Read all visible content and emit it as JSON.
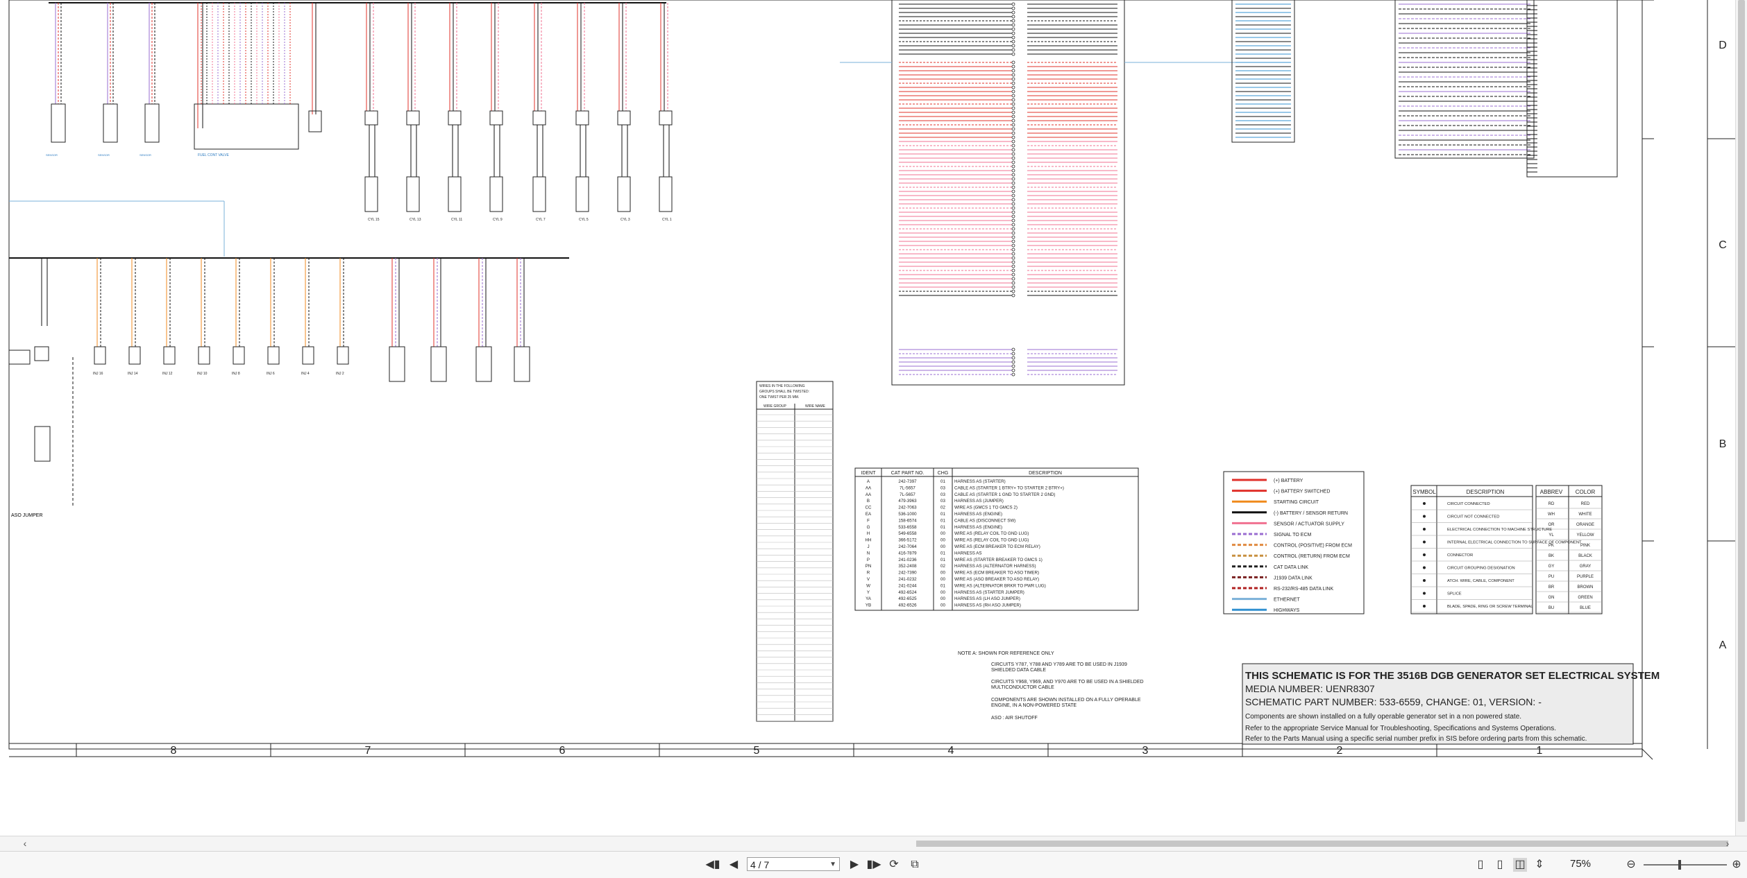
{
  "viewer": {
    "current_page": "4 / 7",
    "zoom": "75%",
    "zoom_fraction": 0.42
  },
  "toolbar_icons": [
    "first-page-icon",
    "previous-page-icon",
    "next-page-icon",
    "last-page-icon",
    "rotate-icon",
    "spread-icon",
    "single-page-view-icon",
    "continuous-view-icon",
    "two-page-view-icon",
    "fit-width-icon",
    "zoom-out-icon",
    "zoom-in-icon"
  ],
  "schematic": {
    "zone_columns": [
      "8",
      "7",
      "6",
      "5",
      "4",
      "3",
      "2",
      "1"
    ],
    "zone_rows": [
      "D",
      "C",
      "B",
      "A"
    ],
    "cylinder_labels_top": [
      "CYL 15",
      "CYL 13",
      "CYL 11",
      "CYL 9",
      "CYL 7",
      "CYL 5",
      "CYL 3",
      "CYL 1"
    ],
    "cylinder_labels_bottom": [
      "INJ 16",
      "INJ 14",
      "INJ 12",
      "INJ 10",
      "INJ 8",
      "INJ 6",
      "INJ 4",
      "INJ 2"
    ],
    "left_label": "ASO JUMPER",
    "twisted_pairs": {
      "heading": [
        "WIRES IN THE FOLLOWING",
        "GROUPS SHALL BE TWISTED:",
        "ONE TWIST PER 25 MM."
      ],
      "col1": "WIRE GROUP",
      "col2": "WIRE NAME"
    },
    "harness_table": {
      "headers": [
        "IDENT",
        "CAT PART NO.",
        "CHG",
        "DESCRIPTION"
      ],
      "rows": [
        [
          "A",
          "242-7397",
          "01",
          "HARNESS AS (STARTER)"
        ],
        [
          "AA",
          "7L-5657",
          "03",
          "CABLE AS (STARTER 1 BTRY+ TO STARTER 2 BTRY+)"
        ],
        [
          "AA",
          "7L-5657",
          "03",
          "CABLE AS (STARTER 1 GND TO STARTER 2 GND)"
        ],
        [
          "B",
          "479-3963",
          "03",
          "HARNESS AS (JUMPER)"
        ],
        [
          "CC",
          "242-7063",
          "02",
          "WIRE AS (GMCS 1 TO GMCS 2)"
        ],
        [
          "EA",
          "536-1000",
          "01",
          "HARNESS AS (ENGINE)"
        ],
        [
          "F",
          "158-6574",
          "01",
          "CABLE AS (DISCONNECT SW)"
        ],
        [
          "G",
          "533-6558",
          "01",
          "HARNESS AS (ENGINE)"
        ],
        [
          "H",
          "549-6558",
          "00",
          "WIRE AS (RELAY COIL TO GND LUG)"
        ],
        [
          "HH",
          "366-5172",
          "00",
          "WIRE AS (RELAY COIL TO GND LUG)"
        ],
        [
          "J",
          "242-7064",
          "00",
          "WIRE AS (ECM BREAKER TO ECM RELAY)"
        ],
        [
          "N",
          "416-7879",
          "01",
          "HARNESS AS"
        ],
        [
          "P",
          "241-0236",
          "01",
          "WIRE AS (STARTER BREAKER TO GMCS 1)"
        ],
        [
          "PN",
          "352-2408",
          "02",
          "HARNESS AS (ALTERNATOR HARNESS)"
        ],
        [
          "R",
          "242-7390",
          "00",
          "WIRE AS (ECM BREAKER TO ASO TIMER)"
        ],
        [
          "V",
          "241-0232",
          "00",
          "WIRE AS (ASO BREAKER TO ASO RELAY)"
        ],
        [
          "W",
          "241-0244",
          "01",
          "WIRE AS (ALTERNATOR BRKR TO PWR LUG)"
        ],
        [
          "Y",
          "492-6524",
          "00",
          "HARNESS AS (STARTER JUMPER)"
        ],
        [
          "YA",
          "492-6525",
          "00",
          "HARNESS AS (LH ASO JUMPER)"
        ],
        [
          "YB",
          "492-6526",
          "00",
          "HARNESS AS (RH ASO JUMPER)"
        ]
      ]
    },
    "wire_legend": [
      {
        "label": "(+) BATTERY",
        "color": "#e0302a",
        "style": "solid"
      },
      {
        "label": "(+) BATTERY SWITCHED",
        "color": "#e0302a",
        "style": "solid"
      },
      {
        "label": "STARTING CIRCUIT",
        "color": "#f08a1c",
        "style": "solid"
      },
      {
        "label": "(-) BATTERY / SENSOR RETURN",
        "color": "#111111",
        "style": "solid"
      },
      {
        "label": "SENSOR / ACTUATOR SUPPLY",
        "color": "#f07090",
        "style": "solid"
      },
      {
        "label": "SIGNAL TO ECM",
        "color": "#9a6cd0",
        "style": "dash"
      },
      {
        "label": "CONTROL (POSITIVE) FROM ECM",
        "color": "#e08a40",
        "style": "dash"
      },
      {
        "label": "CONTROL (RETURN) FROM ECM",
        "color": "#c89040",
        "style": "dash"
      },
      {
        "label": "CAT DATA LINK",
        "color": "#222222",
        "style": "dash"
      },
      {
        "label": "J1939 DATA LINK",
        "color": "#7a2020",
        "style": "dash"
      },
      {
        "label": "RS-232/RS-485 DATA LINK",
        "color": "#b02020",
        "style": "dash"
      },
      {
        "label": "ETHERNET",
        "color": "#7ab0d8",
        "style": "solid"
      },
      {
        "label": "HIGHWAYS",
        "color": "#3090d0",
        "style": "solid"
      }
    ],
    "symbol_table": {
      "headers": [
        "SYMBOL",
        "DESCRIPTION"
      ],
      "rows": [
        "CIRCUIT CONNECTED",
        "CIRCUIT NOT CONNECTED",
        "ELECTRICAL CONNECTION TO MACHINE STRUCTURE",
        "INTERNAL ELECTRICAL CONNECTION TO SURFACE OF COMPONENT",
        "CONNECTOR",
        "CIRCUIT GROUPING DESIGNATION",
        "ATCH. WIRE, CABLE, COMPONENT",
        "SPLICE",
        "BLADE, SPADE, RING OR SCREW TERMINAL"
      ]
    },
    "color_table": {
      "headers": [
        "ABBREV",
        "COLOR"
      ],
      "rows": [
        [
          "RD",
          "RED"
        ],
        [
          "WH",
          "WHITE"
        ],
        [
          "OR",
          "ORANGE"
        ],
        [
          "YL",
          "YELLOW"
        ],
        [
          "PK",
          "PINK"
        ],
        [
          "BK",
          "BLACK"
        ],
        [
          "GY",
          "GRAY"
        ],
        [
          "PU",
          "PURPLE"
        ],
        [
          "BR",
          "BROWN"
        ],
        [
          "GN",
          "GREEN"
        ],
        [
          "BU",
          "BLUE"
        ]
      ]
    },
    "notes": [
      "NOTE A: SHOWN FOR REFERENCE ONLY",
      "CIRCUITS Y787, Y788 AND Y789 ARE TO BE USED IN J1939",
      "SHIELDED DATA CABLE",
      "CIRCUITS Y968, Y969, AND Y970 ARE TO BE USED IN A SHIELDED",
      "MULTICONDUCTOR CABLE",
      "COMPONENTS ARE SHOWN INSTALLED ON A FULLY OPERABLE",
      "ENGINE, IN A NON-POWERED STATE",
      "ASO : AIR SHUTOFF"
    ],
    "title_block": {
      "title": "THIS SCHEMATIC IS FOR THE 3516B DGB GENERATOR SET ELECTRICAL SYSTEM",
      "media": "MEDIA NUMBER: UENR8307",
      "part": "SCHEMATIC PART NUMBER: 533-6559, CHANGE: 01, VERSION: -",
      "line1": "Components are shown installed on a fully operable generator set in a non powered state.",
      "line2": "Refer to the appropriate Service Manual for Troubleshooting, Specifications and Systems Operations.",
      "line3": "Refer to the Parts Manual using a specific serial number prefix in SIS before ordering parts from this schematic."
    }
  }
}
